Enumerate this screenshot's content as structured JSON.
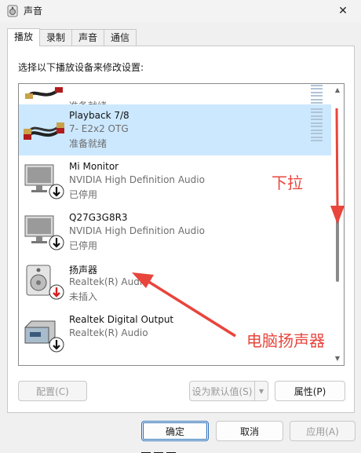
{
  "window": {
    "title": "声音",
    "close_glyph": "✕",
    "icon": "speaker-icon"
  },
  "tabs": [
    {
      "label": "播放",
      "active": true
    },
    {
      "label": "录制",
      "active": false
    },
    {
      "label": "声音",
      "active": false
    },
    {
      "label": "通信",
      "active": false
    }
  ],
  "prompt": "选择以下播放设备来修改设置:",
  "devices": [
    {
      "name": "",
      "desc": "",
      "status": "准备就绪",
      "icon": "rca-cable-icon",
      "selected": false
    },
    {
      "name": "Playback 7/8",
      "desc": "7- E2x2 OTG",
      "status": "准备就绪",
      "icon": "rca-cable-icon",
      "selected": true
    },
    {
      "name": "Mi Monitor",
      "desc": "NVIDIA High Definition Audio",
      "status": "已停用",
      "icon": "monitor-icon",
      "selected": false
    },
    {
      "name": "Q27G3G8R3",
      "desc": "NVIDIA High Definition Audio",
      "status": "已停用",
      "icon": "monitor-icon",
      "selected": false
    },
    {
      "name": "扬声器",
      "desc": "Realtek(R) Audio",
      "status": "未插入",
      "icon": "speaker-icon",
      "selected": false
    },
    {
      "name": "Realtek Digital Output",
      "desc": "Realtek(R) Audio",
      "status": "",
      "icon": "digital-output-icon",
      "selected": false
    }
  ],
  "buttons": {
    "configure": "配置(C)",
    "set_default": "设为默认值(S)",
    "properties": "属性(P)",
    "ok": "确定",
    "cancel": "取消",
    "apply": "应用(A)"
  },
  "annotations": {
    "scroll_down": "下拉",
    "pc_speaker": "电脑扬声器"
  },
  "colors": {
    "selection": "#cce8ff",
    "annotation": "#e8453c",
    "status_red": "#d42020"
  }
}
